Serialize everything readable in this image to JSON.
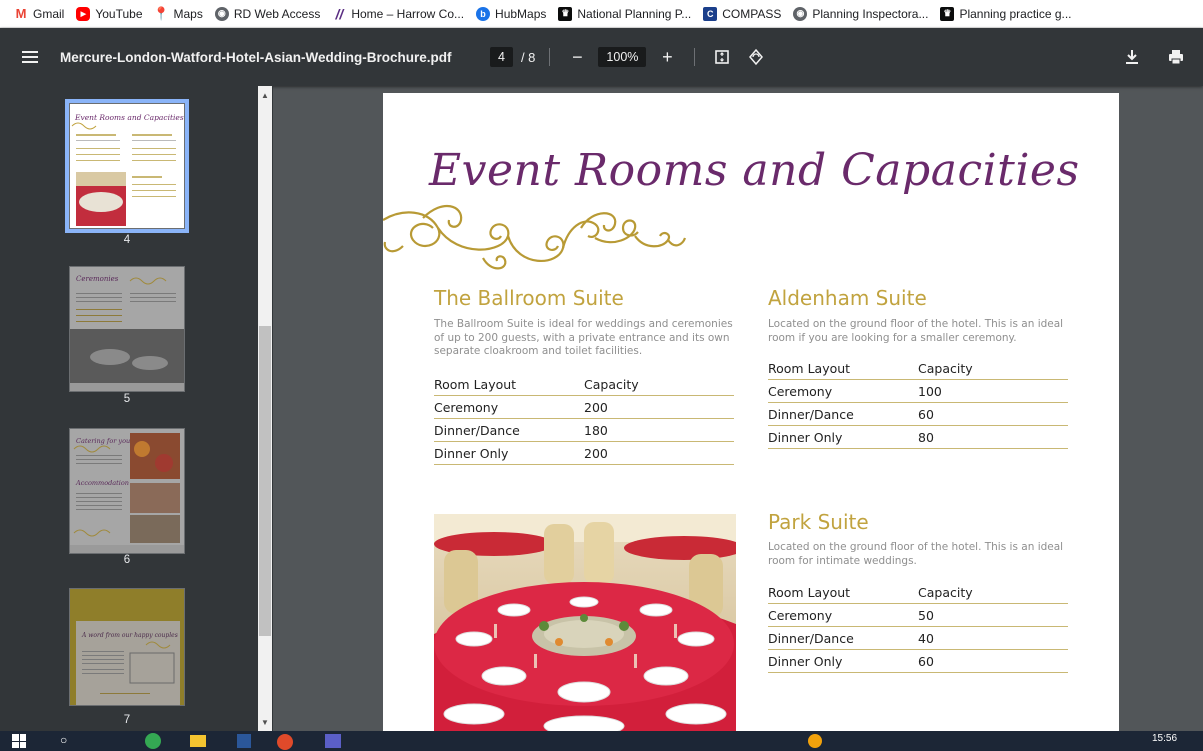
{
  "bookmarks": [
    {
      "label": "Gmail",
      "icon": "gmail-icon",
      "color": "#ea4335"
    },
    {
      "label": "YouTube",
      "icon": "youtube-icon",
      "color": "#ff0000"
    },
    {
      "label": "Maps",
      "icon": "maps-icon",
      "color": "#34a853"
    },
    {
      "label": "RD Web Access",
      "icon": "globe-icon",
      "color": "#5f6368"
    },
    {
      "label": "Home – Harrow Co...",
      "icon": "harrow-icon",
      "color": "#5a2d82"
    },
    {
      "label": "HubMaps",
      "icon": "hubmaps-icon",
      "color": "#1a73e8"
    },
    {
      "label": "National Planning P...",
      "icon": "govuk-icon",
      "color": "#0b0c0c"
    },
    {
      "label": "COMPASS",
      "icon": "compass-icon",
      "color": "#1b3f8b"
    },
    {
      "label": "Planning Inspectora...",
      "icon": "globe-icon",
      "color": "#5f6368"
    },
    {
      "label": "Planning practice g...",
      "icon": "govuk-icon",
      "color": "#0b0c0c"
    }
  ],
  "toolbar": {
    "title": "Mercure-London-Watford-Hotel-Asian-Wedding-Brochure.pdf",
    "current_page": "4",
    "total_pages": "/ 8",
    "zoom": "100%"
  },
  "thumbnails": [
    {
      "page": "4",
      "selected": true
    },
    {
      "page": "5",
      "selected": false
    },
    {
      "page": "6",
      "selected": false
    },
    {
      "page": "7",
      "selected": false
    }
  ],
  "thumb_texts": {
    "p4": "Event Rooms and Capacities",
    "p5": "Ceremonies",
    "p6a": "Catering for you",
    "p6b": "Accommodation",
    "p7": "A word from our happy couples"
  },
  "document": {
    "heading": "Event Rooms and Capacities",
    "ballroom": {
      "title": "The Ballroom Suite",
      "desc_lines": [
        "The Ballroom Suite is ideal for weddings and ceremonies",
        "of up to 200 guests, with a private entrance and its own",
        "separate cloakroom and toilet facilities."
      ],
      "header": [
        "Room Layout",
        "Capacity"
      ],
      "rows": [
        [
          "Ceremony",
          "200"
        ],
        [
          "Dinner/Dance",
          "180"
        ],
        [
          "Dinner Only",
          "200"
        ]
      ]
    },
    "aldenham": {
      "title": "Aldenham Suite",
      "desc_lines": [
        "Located on the ground floor of the hotel. This is an ideal",
        "room if you are looking for a smaller ceremony."
      ],
      "header": [
        "Room Layout",
        "Capacity"
      ],
      "rows": [
        [
          "Ceremony",
          "100"
        ],
        [
          "Dinner/Dance",
          "60"
        ],
        [
          "Dinner Only",
          "80"
        ]
      ]
    },
    "park": {
      "title": "Park Suite",
      "desc_lines": [
        "Located on the ground floor of the hotel. This is an ideal",
        "room for intimate weddings."
      ],
      "header": [
        "Room Layout",
        "Capacity"
      ],
      "rows": [
        [
          "Ceremony",
          "50"
        ],
        [
          "Dinner/Dance",
          "40"
        ],
        [
          "Dinner Only",
          "60"
        ]
      ]
    }
  },
  "taskbar": {
    "time": "15:56"
  },
  "colors": {
    "heading": "#6a2a6b",
    "gold": "#c1a33f",
    "toolbar": "#323639",
    "viewer_bg": "#525659"
  }
}
